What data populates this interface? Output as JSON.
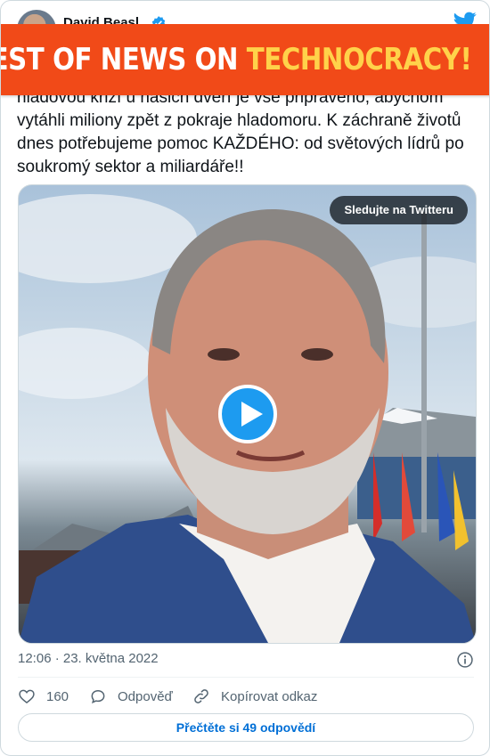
{
  "header": {
    "author_name": "David Beasl",
    "verified_icon": "verified-badge-icon",
    "logo_icon": "twitter-bird-icon"
  },
  "banner": {
    "text_white": "ILY DIGEST OF NEWS ON ",
    "text_yellow": "TECHNOCRACY!",
    "background": "#f14a18",
    "accent": "#ffd24a"
  },
  "tweet": {
    "text": "hladovou krizí u našich dveří je vše připraveno, abychom vytáhli miliony zpět z pokraje hladomoru. K záchraně životů dnes potřebujeme pomoc KAŽDÉHO: od světových lídrů po soukromý sektor a miliardáře!!"
  },
  "media": {
    "watch_label": "Sledujte na Twitteru",
    "play_icon": "play-icon"
  },
  "meta": {
    "timestamp": "12:06 · 23. května 2022",
    "info_icon": "info-icon"
  },
  "actions": {
    "like_count": "160",
    "reply_label": "Odpověď",
    "copy_label": "Kopírovat odkaz"
  },
  "footer": {
    "read_replies_label": "Přečtěte si 49 odpovědí"
  },
  "colors": {
    "link": "#006fd6",
    "brand": "#1d9bf0",
    "muted": "#536471"
  }
}
